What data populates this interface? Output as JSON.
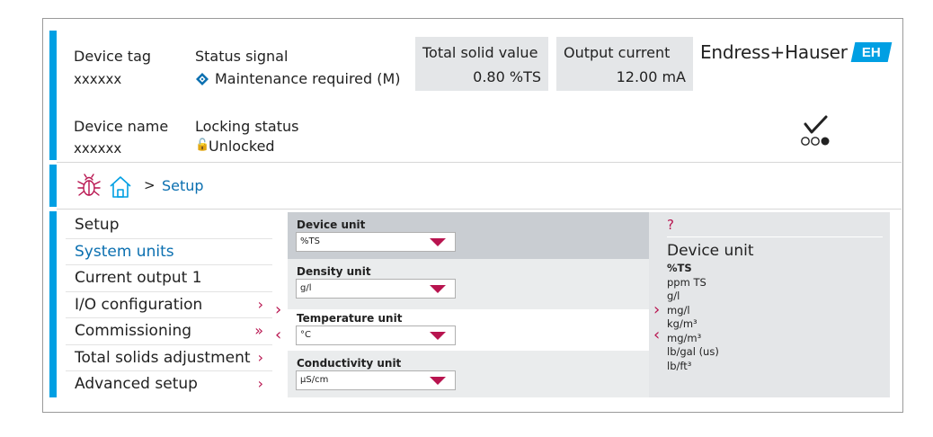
{
  "header": {
    "device_tag_label": "Device tag",
    "device_tag_value": "xxxxxx",
    "status_signal_label": "Status signal",
    "status_signal_value": "Maintenance required (M)",
    "total_solid_label": "Total solid value",
    "total_solid_value": "0.80 %TS",
    "output_current_label": "Output current",
    "output_current_value": "12.00 mA",
    "device_name_label": "Device name",
    "device_name_value": "xxxxxx",
    "locking_status_label": "Locking status",
    "locking_status_value": "Unlocked",
    "lock_glyph": "🔓"
  },
  "logo": {
    "text": "Endress+Hauser",
    "mark": "EH"
  },
  "icons": {
    "status": "maintenance-diamond-icon",
    "check": "checkmark-dots-icon",
    "bug": "bug-icon",
    "home": "home-icon"
  },
  "colors": {
    "accent": "#009fe3",
    "magenta": "#b8144f",
    "link": "#0a6fb0"
  },
  "breadcrumb": {
    "separator": ">",
    "current": "Setup"
  },
  "nav": {
    "items": [
      {
        "label": "Setup",
        "chevron": ""
      },
      {
        "label": "System units",
        "chevron": ""
      },
      {
        "label": "Current output 1",
        "chevron": ""
      },
      {
        "label": "I/O configuration",
        "chevron": "›"
      },
      {
        "label": "Commissioning",
        "chevron": "»"
      },
      {
        "label": "Total solids adjustment",
        "chevron": "›"
      },
      {
        "label": "Advanced setup",
        "chevron": "›"
      }
    ]
  },
  "nav_arrows": {
    "right": "›",
    "left": "‹"
  },
  "fields": [
    {
      "label": "Device unit",
      "value": "%TS"
    },
    {
      "label": "Density unit",
      "value": "g/l"
    },
    {
      "label": "Temperature unit",
      "value": "°C"
    },
    {
      "label": "Conductivity unit",
      "value": "µS/cm"
    }
  ],
  "help": {
    "marker": "?",
    "title": "Device unit",
    "options": [
      "%TS",
      "ppm TS",
      "g/l",
      "mg/l",
      "kg/m³",
      "mg/m³",
      "lb/gal (us)",
      "lb/ft³"
    ],
    "selected_index": 0,
    "arrows": {
      "right": "›",
      "left": "‹"
    }
  }
}
